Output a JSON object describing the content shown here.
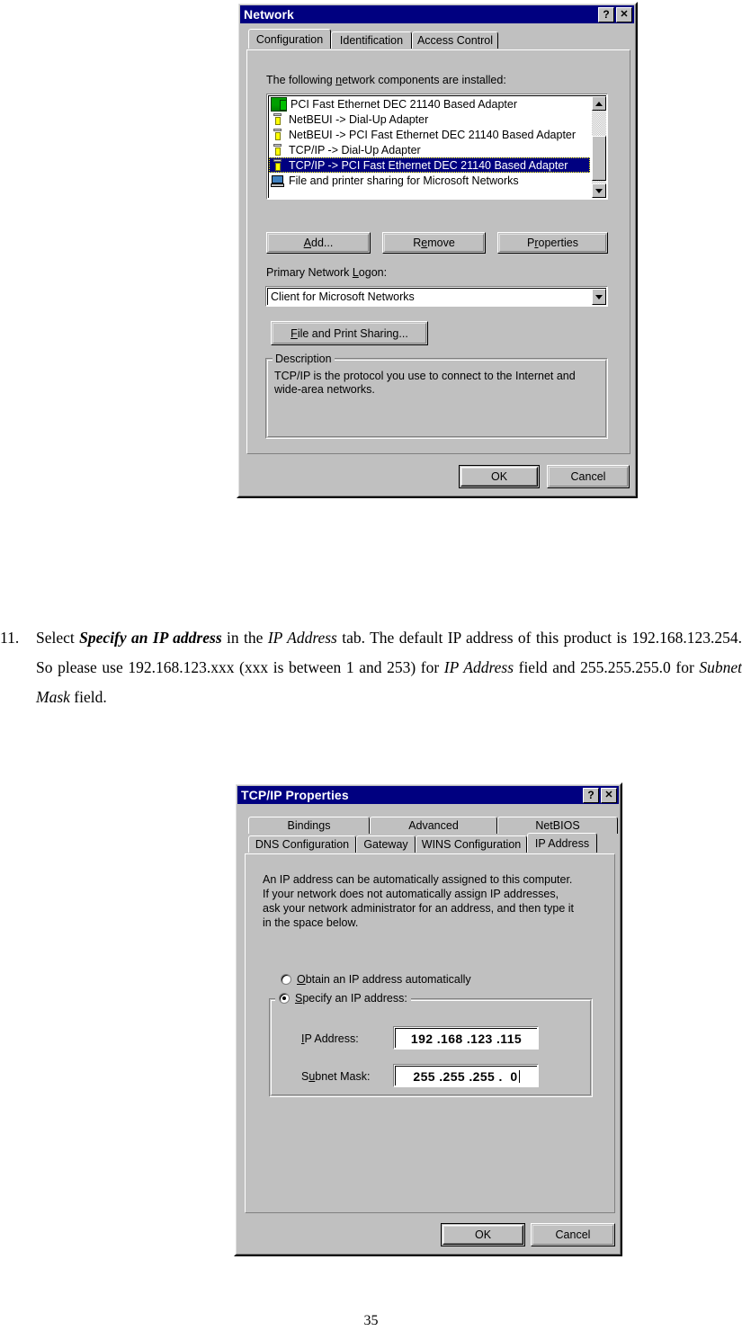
{
  "page": {
    "number": "35"
  },
  "instruction": {
    "marker": "11.",
    "seg1": "Select ",
    "em1": "Specify an IP address",
    "seg2": " in the ",
    "em2": "IP Address",
    "seg3": " tab. The default IP address of this product is 192.168.123.254. So please use 192.168.123.xxx (xxx is between 1 and 253) for ",
    "em3": "IP Address",
    "seg4": " field and 255.255.255.0 for ",
    "em4": "Subnet Mask",
    "seg5": " field."
  },
  "network_dialog": {
    "title": "Network",
    "help_button": "?",
    "close_button": "✕",
    "tabs": [
      {
        "label": "Configuration",
        "active": true
      },
      {
        "label": "Identification",
        "active": false
      },
      {
        "label": "Access Control",
        "active": false
      }
    ],
    "list_label_pre": "The following ",
    "list_label_key": "n",
    "list_label_post": "etwork components are installed:",
    "components": [
      {
        "label": "PCI Fast Ethernet DEC 21140 Based Adapter",
        "icon": "network-adapter-icon",
        "selected": false
      },
      {
        "label": "NetBEUI -> Dial-Up Adapter",
        "icon": "protocol-icon",
        "selected": false
      },
      {
        "label": "NetBEUI -> PCI Fast Ethernet DEC 21140 Based Adapter",
        "icon": "protocol-icon",
        "selected": false
      },
      {
        "label": "TCP/IP -> Dial-Up Adapter",
        "icon": "protocol-icon",
        "selected": false
      },
      {
        "label": "TCP/IP -> PCI Fast Ethernet DEC 21140 Based Adapter",
        "icon": "protocol-icon",
        "selected": true
      },
      {
        "label": "File and printer sharing for Microsoft Networks",
        "icon": "computer-icon",
        "selected": false
      }
    ],
    "buttons": {
      "add": "Add...",
      "remove": "Remove",
      "properties": "Properties",
      "file_print_sharing": "File and Print Sharing..."
    },
    "primary_logon_label": "Primary Network Logon:",
    "primary_logon_value": "Client for Microsoft Networks",
    "description": {
      "title": "Description",
      "text": "TCP/IP is the protocol you use to connect to the Internet and wide-area networks."
    },
    "ok": "OK",
    "cancel": "Cancel"
  },
  "tcpip_dialog": {
    "title": "TCP/IP Properties",
    "help_button": "?",
    "close_button": "✕",
    "tabs_row1": [
      {
        "label": "Bindings",
        "active": false
      },
      {
        "label": "Advanced",
        "active": false
      },
      {
        "label": "NetBIOS",
        "active": false
      }
    ],
    "tabs_row2": [
      {
        "label": "DNS Configuration",
        "active": false
      },
      {
        "label": "Gateway",
        "active": false
      },
      {
        "label": "WINS Configuration",
        "active": false
      },
      {
        "label": "IP Address",
        "active": true
      }
    ],
    "description": "An IP address can be automatically assigned to this computer. If your network does not automatically assign IP addresses, ask your network administrator for an address, and then type it in the space below.",
    "radio_obtain": "Obtain an IP address automatically",
    "radio_obtain_selected": false,
    "radio_specify": "Specify an IP address:",
    "radio_specify_selected": true,
    "ip_address_label": "IP Address:",
    "ip_address_value": "192 .168 .123 .115",
    "subnet_mask_label": "Subnet Mask:",
    "subnet_mask_value": "255 .255 .255 .  0",
    "ok": "OK",
    "cancel": "Cancel"
  }
}
